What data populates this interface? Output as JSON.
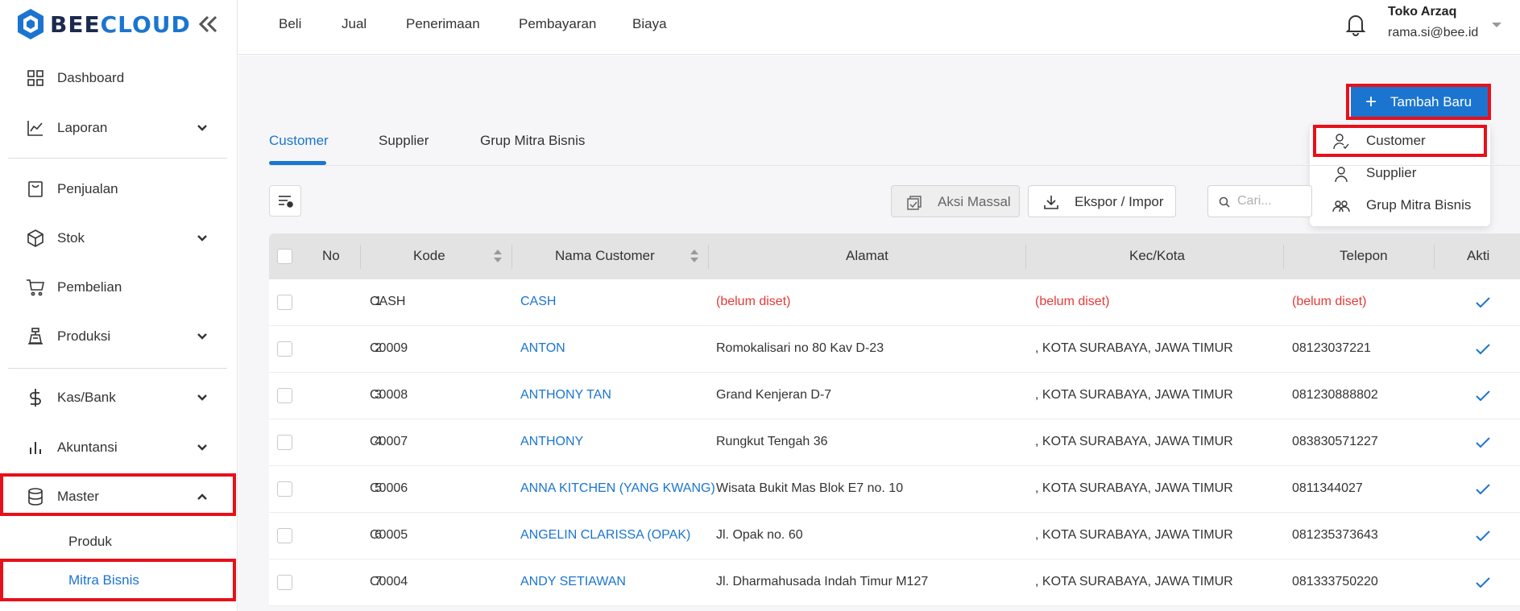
{
  "brand": {
    "part1": "BEE",
    "part2": "CLOUD",
    "primary": "#1b75d0",
    "dark": "#1b2a4e",
    "highlight": "#e8101a"
  },
  "sidebar": {
    "items": [
      {
        "label": "Dashboard",
        "icon": "dashboard-grid-icon"
      },
      {
        "label": "Laporan",
        "icon": "chart-line-icon"
      },
      {
        "label": "Penjualan",
        "icon": "shopping-bag-icon"
      },
      {
        "label": "Stok",
        "icon": "box-icon"
      },
      {
        "label": "Pembelian",
        "icon": "cart-icon"
      },
      {
        "label": "Produksi",
        "icon": "factory-icon"
      },
      {
        "label": "Kas/Bank",
        "icon": "dollar-icon"
      },
      {
        "label": "Akuntansi",
        "icon": "bar-chart-icon"
      },
      {
        "label": "Master",
        "icon": "database-icon"
      }
    ],
    "sub_items": [
      {
        "label": "Produk"
      },
      {
        "label": "Mitra Bisnis"
      }
    ]
  },
  "topnav": {
    "menu": [
      "Beli",
      "Jual",
      "Penerimaan",
      "Pembayaran",
      "Biaya"
    ],
    "user_name": "Toko Arzaq",
    "user_email": "rama.si@bee.id"
  },
  "actions": {
    "add_new": "Tambah Baru",
    "bulk_action": "Aksi Massal",
    "export_import": "Ekspor / Impor",
    "search_placeholder": "Cari..."
  },
  "add_menu": {
    "items": [
      {
        "label": "Customer",
        "icon": "customer-icon"
      },
      {
        "label": "Supplier",
        "icon": "supplier-icon"
      },
      {
        "label": "Grup Mitra Bisnis",
        "icon": "group-icon"
      }
    ]
  },
  "tabs": [
    "Customer",
    "Supplier",
    "Grup Mitra Bisnis"
  ],
  "table": {
    "headers": [
      "No",
      "Kode",
      "Nama Customer",
      "Alamat",
      "Kec/Kota",
      "Telepon",
      "Akti"
    ],
    "rows": [
      {
        "no": "1",
        "code": "CASH",
        "name": "CASH",
        "address": "(belum diset)",
        "city": "(belum diset)",
        "phone": "(belum diset)"
      },
      {
        "no": "2",
        "code": "C0009",
        "name": "ANTON",
        "address": "Romokalisari no 80 Kav D-23",
        "city": ", KOTA SURABAYA, JAWA TIMUR",
        "phone": "08123037221"
      },
      {
        "no": "3",
        "code": "C0008",
        "name": "ANTHONY TAN",
        "address": "Grand Kenjeran D-7",
        "city": ", KOTA SURABAYA, JAWA TIMUR",
        "phone": "081230888802"
      },
      {
        "no": "4",
        "code": "C0007",
        "name": "ANTHONY",
        "address": "Rungkut Tengah 36",
        "city": ", KOTA SURABAYA, JAWA TIMUR",
        "phone": "083830571227"
      },
      {
        "no": "5",
        "code": "C0006",
        "name": "ANNA KITCHEN (YANG KWANG)",
        "address": "Wisata Bukit Mas Blok E7 no. 10",
        "city": ", KOTA SURABAYA, JAWA TIMUR",
        "phone": "0811344027"
      },
      {
        "no": "6",
        "code": "C0005",
        "name": "ANGELIN CLARISSA (OPAK)",
        "address": "Jl. Opak no. 60",
        "city": ", KOTA SURABAYA, JAWA TIMUR",
        "phone": "081235373643"
      },
      {
        "no": "7",
        "code": "C0004",
        "name": "ANDY SETIAWAN",
        "address": "Jl. Dharmahusada Indah Timur M127",
        "city": ", KOTA SURABAYA, JAWA TIMUR",
        "phone": "081333750220"
      }
    ]
  }
}
